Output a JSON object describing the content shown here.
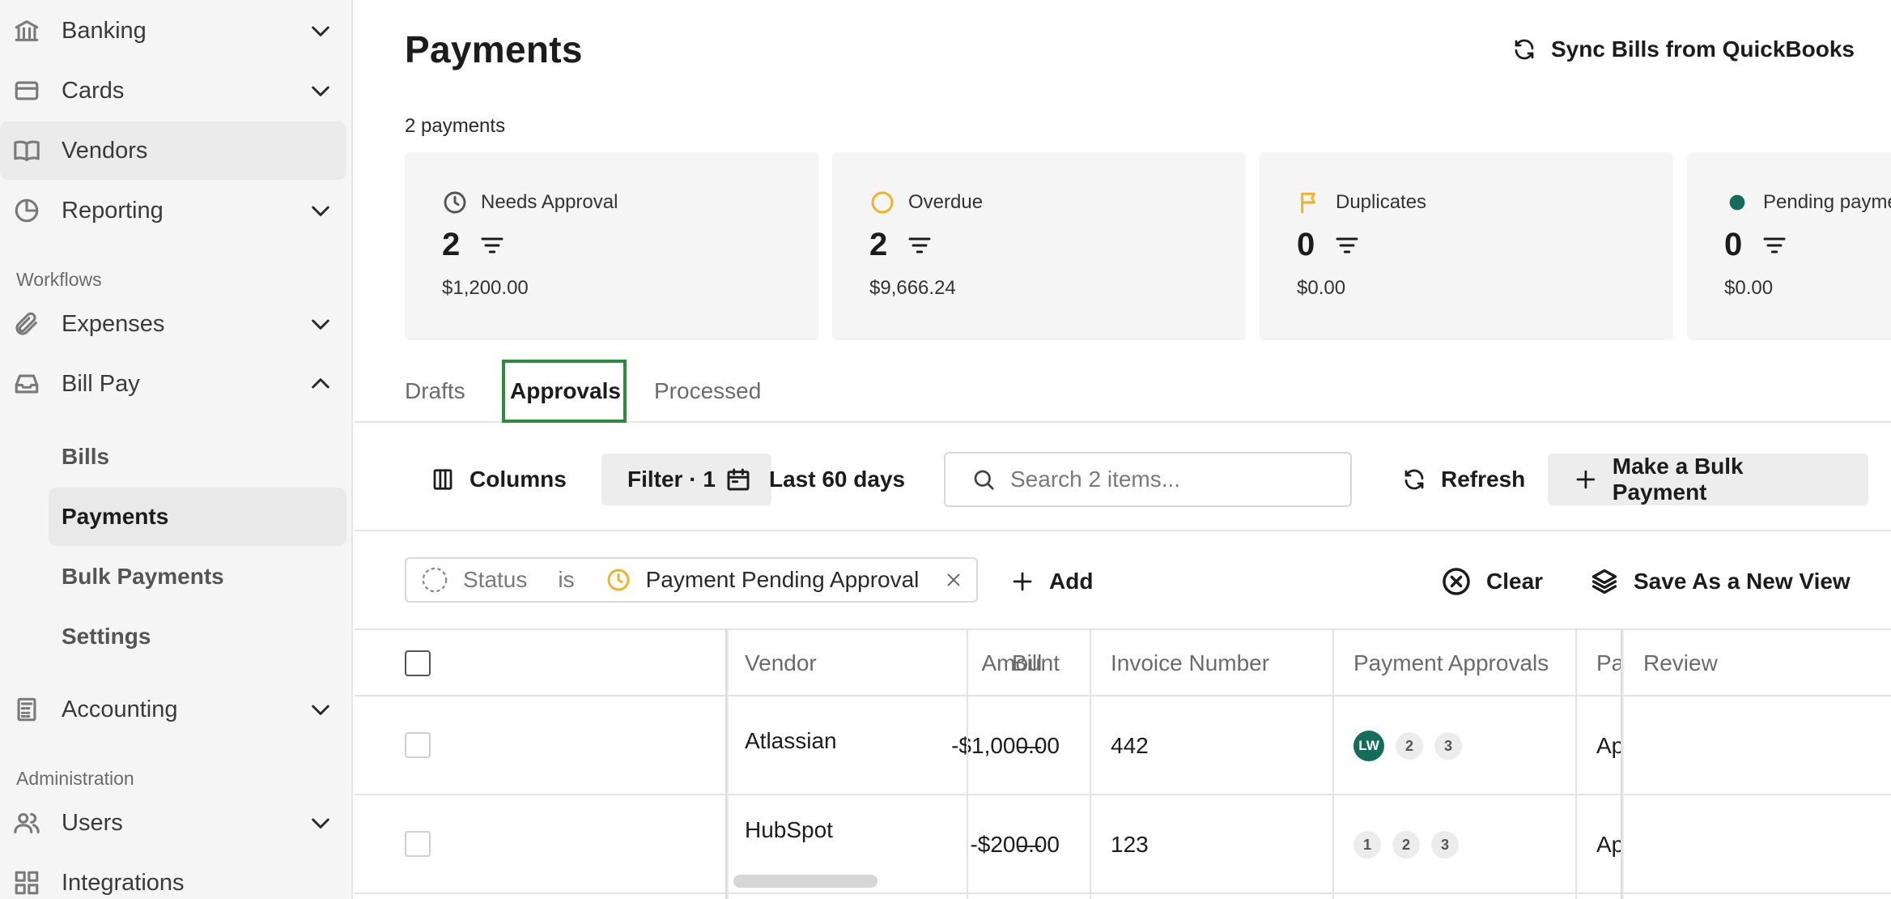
{
  "sidebar": {
    "items": [
      {
        "label": "Banking",
        "icon": "bank-icon"
      },
      {
        "label": "Cards",
        "icon": "card-icon"
      },
      {
        "label": "Vendors",
        "icon": "book-icon"
      },
      {
        "label": "Reporting",
        "icon": "pie-chart-icon"
      },
      {
        "label": "Expenses",
        "icon": "paperclip-icon"
      },
      {
        "label": "Bill Pay",
        "icon": "inbox-icon"
      },
      {
        "label": "Accounting",
        "icon": "calculator-icon"
      },
      {
        "label": "Users",
        "icon": "users-icon"
      },
      {
        "label": "Integrations",
        "icon": "grid-icon"
      }
    ],
    "sections": {
      "workflows": "Workflows",
      "administration": "Administration"
    },
    "billpay_sub": [
      "Bills",
      "Payments",
      "Bulk Payments",
      "Settings"
    ]
  },
  "header": {
    "title": "Payments",
    "sync_label": "Sync Bills from QuickBooks",
    "count_label": "2 payments"
  },
  "cards": [
    {
      "label": "Needs Approval",
      "count": "2",
      "amount": "$1,200.00",
      "icon": "clock-icon"
    },
    {
      "label": "Overdue",
      "count": "2",
      "amount": "$9,666.24",
      "icon": "circle-icon",
      "color": "#f0b323"
    },
    {
      "label": "Duplicates",
      "count": "0",
      "amount": "$0.00",
      "icon": "flag-icon",
      "color": "#f0b323"
    },
    {
      "label": "Pending payme",
      "count": "0",
      "amount": "$0.00",
      "icon": "dot-icon",
      "color": "#146c5a"
    }
  ],
  "tabs": [
    "Drafts",
    "Approvals",
    "Processed"
  ],
  "toolbar": {
    "columns": "Columns",
    "filter": "Filter · 1",
    "date_range": "Last 60 days",
    "search_placeholder": "Search 2 items...",
    "refresh": "Refresh",
    "bulk": "Make a Bulk Payment"
  },
  "filter_chip": {
    "field": "Status",
    "op": "is",
    "value": "Payment Pending Approval"
  },
  "filter_actions": {
    "add": "Add",
    "clear": "Clear",
    "save_view": "Save As a New View"
  },
  "table": {
    "headers": {
      "amount": "Amount",
      "vendor": "Vendor",
      "bill": "Bill",
      "invoice": "Invoice Number",
      "approvals": "Payment Approvals",
      "pa": "Pa",
      "review": "Review"
    },
    "rows": [
      {
        "amount": "-$1,000.00",
        "vendor": "Atlassian",
        "bill": "—",
        "invoice": "442",
        "approvers": [
          "LW",
          "2",
          "3"
        ],
        "pa": "Ap"
      },
      {
        "amount": "-$200.00",
        "vendor": "HubSpot",
        "bill": "—",
        "invoice": "123",
        "approvers": [
          "1",
          "2",
          "3"
        ],
        "pa": "Ap"
      }
    ]
  },
  "colors": {
    "accent_green": "#146c5a",
    "warning": "#f0b323",
    "focus": "#2e8b3e"
  }
}
